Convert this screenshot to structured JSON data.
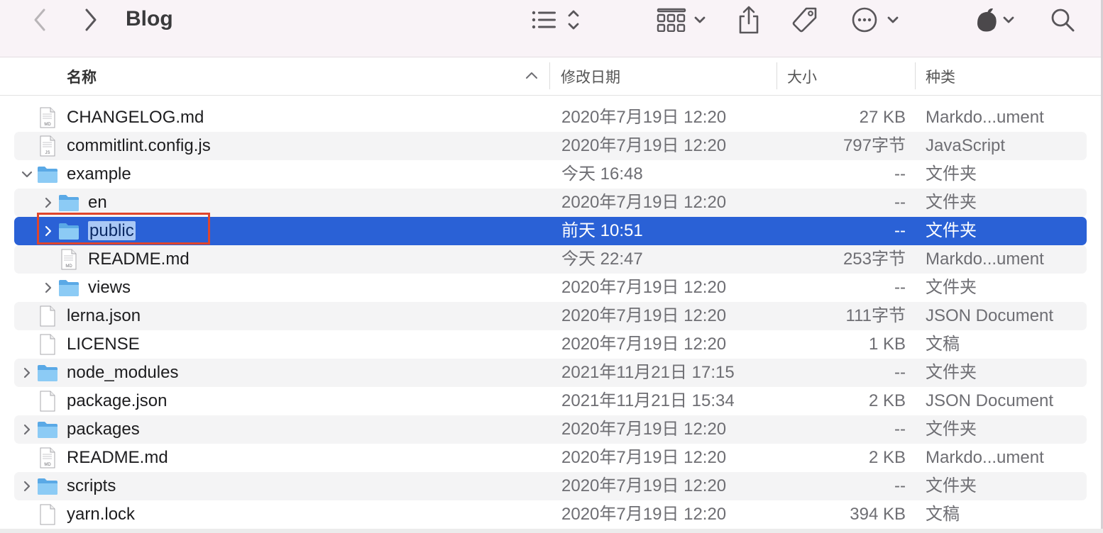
{
  "window": {
    "title": "Blog",
    "toolbar": {
      "back_icon": "chevron-left-icon",
      "forward_icon": "chevron-right-icon",
      "view_icon": "list-view-icon",
      "group_icon": "grid-group-icon",
      "share_icon": "share-icon",
      "tag_icon": "tag-icon",
      "more_icon": "ellipsis-circle-icon",
      "app_icon": "app-icon",
      "search_icon": "search-icon"
    }
  },
  "columns": {
    "name": "名称",
    "date": "修改日期",
    "size": "大小",
    "kind": "种类",
    "sort_indicator": "chevron-up-icon"
  },
  "accent_color": "#2a61d6",
  "rows": [
    {
      "name": "CHANGELOG.md",
      "date": "2020年7月19日 12:20",
      "size": "27 KB",
      "kind": "Markdo...ument",
      "type": "doc",
      "badge": "MD",
      "level": 0,
      "expander": "none"
    },
    {
      "name": "commitlint.config.js",
      "date": "2020年7月19日 12:20",
      "size": "797字节",
      "kind": "JavaScript",
      "type": "doc",
      "badge": "JS",
      "level": 0,
      "expander": "none"
    },
    {
      "name": "example",
      "date": "今天 16:48",
      "size": "--",
      "kind": "文件夹",
      "type": "folder",
      "level": 0,
      "expander": "open"
    },
    {
      "name": "en",
      "date": "2020年7月19日 12:20",
      "size": "--",
      "kind": "文件夹",
      "type": "folder",
      "level": 1,
      "expander": "closed"
    },
    {
      "name": "public",
      "date": "前天 10:51",
      "size": "--",
      "kind": "文件夹",
      "type": "folder",
      "level": 1,
      "expander": "closed",
      "selected": true
    },
    {
      "name": "README.md",
      "date": "今天 22:47",
      "size": "253字节",
      "kind": "Markdo...ument",
      "type": "doc",
      "badge": "MD",
      "level": 1,
      "expander": "none"
    },
    {
      "name": "views",
      "date": "2020年7月19日 12:20",
      "size": "--",
      "kind": "文件夹",
      "type": "folder",
      "level": 1,
      "expander": "closed"
    },
    {
      "name": "lerna.json",
      "date": "2020年7月19日 12:20",
      "size": "111字节",
      "kind": "JSON Document",
      "type": "doc",
      "badge": "",
      "level": 0,
      "expander": "none"
    },
    {
      "name": "LICENSE",
      "date": "2020年7月19日 12:20",
      "size": "1 KB",
      "kind": "文稿",
      "type": "doc",
      "badge": "",
      "level": 0,
      "expander": "none"
    },
    {
      "name": "node_modules",
      "date": "2021年11月21日 17:15",
      "size": "--",
      "kind": "文件夹",
      "type": "folder",
      "level": 0,
      "expander": "closed"
    },
    {
      "name": "package.json",
      "date": "2021年11月21日 15:34",
      "size": "2 KB",
      "kind": "JSON Document",
      "type": "doc",
      "badge": "",
      "level": 0,
      "expander": "none"
    },
    {
      "name": "packages",
      "date": "2020年7月19日 12:20",
      "size": "--",
      "kind": "文件夹",
      "type": "folder",
      "level": 0,
      "expander": "closed"
    },
    {
      "name": "README.md",
      "date": "2020年7月19日 12:20",
      "size": "2 KB",
      "kind": "Markdo...ument",
      "type": "doc",
      "badge": "MD",
      "level": 0,
      "expander": "none"
    },
    {
      "name": "scripts",
      "date": "2020年7月19日 12:20",
      "size": "--",
      "kind": "文件夹",
      "type": "folder",
      "level": 0,
      "expander": "closed"
    },
    {
      "name": "yarn.lock",
      "date": "2020年7月19日 12:20",
      "size": "394 KB",
      "kind": "文稿",
      "type": "doc",
      "badge": "",
      "level": 0,
      "expander": "none"
    }
  ]
}
